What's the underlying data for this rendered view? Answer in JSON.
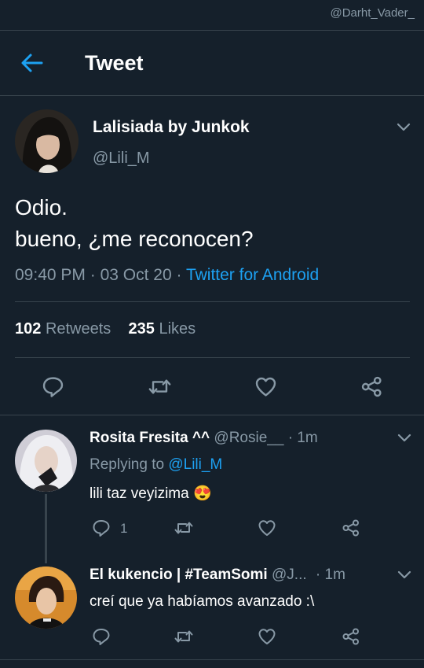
{
  "watermark": "@Darht_Vader_",
  "header": {
    "title": "Tweet"
  },
  "tweet": {
    "author_name": "Lalisiada by Junkok",
    "author_handle": "@Lili_M",
    "text_line1": "Odio.",
    "text_line2": "bueno, ¿me reconocen?",
    "time": "09:40 PM",
    "date": "03 Oct 20",
    "separator": "·",
    "source": "Twitter for Android",
    "retweets_count": "102",
    "retweets_label": "Retweets",
    "likes_count": "235",
    "likes_label": "Likes"
  },
  "replies": [
    {
      "name": "Rosita Fresita ^^",
      "handle": "@Rosie__",
      "dot": "·",
      "time": "1m",
      "replying_prefix": "Replying to",
      "replying_to": "@Lili_M",
      "text": "lili taz veyizima",
      "emoji": "😍",
      "reply_count": "1"
    },
    {
      "name": "El kukencio | #TeamSomi",
      "handle": "@J...",
      "dot": "·",
      "time": "1m",
      "text": "creí que ya habíamos avanzado :\\"
    }
  ],
  "colors": {
    "background": "#15202b",
    "accent": "#1da1f2",
    "secondary_text": "#8899a6",
    "divider": "#38444d"
  },
  "icons": [
    "back-arrow-icon",
    "chevron-down-icon",
    "reply-icon",
    "retweet-icon",
    "like-icon",
    "share-icon"
  ]
}
